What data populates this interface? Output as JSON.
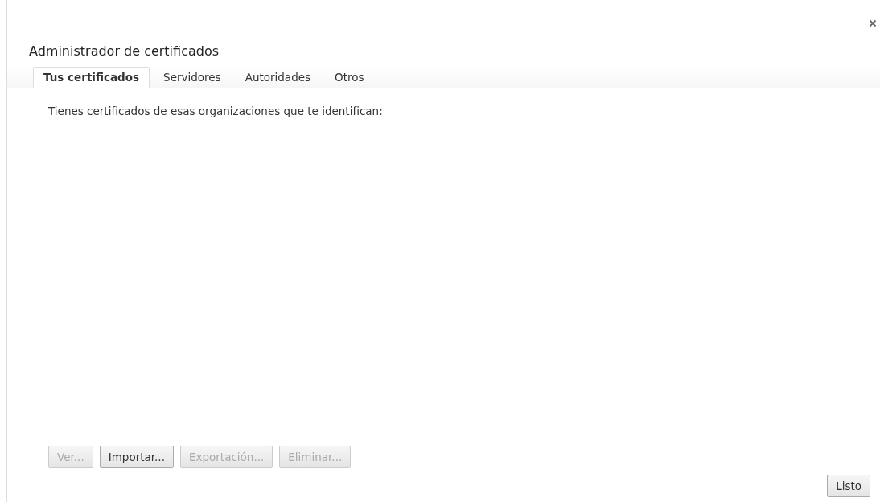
{
  "dialog": {
    "title": "Administrador de certificados"
  },
  "tabs": [
    {
      "label": "Tus certificados",
      "selected": true
    },
    {
      "label": "Servidores",
      "selected": false
    },
    {
      "label": "Autoridades",
      "selected": false
    },
    {
      "label": "Otros",
      "selected": false
    }
  ],
  "description": "Tienes certificados de esas organizaciones que te identifican:",
  "actions": [
    {
      "label": "Ver...",
      "disabled": true
    },
    {
      "label": "Importar...",
      "disabled": false
    },
    {
      "label": "Exportación...",
      "disabled": true
    },
    {
      "label": "Eliminar...",
      "disabled": true
    }
  ],
  "done_button": "Listo"
}
